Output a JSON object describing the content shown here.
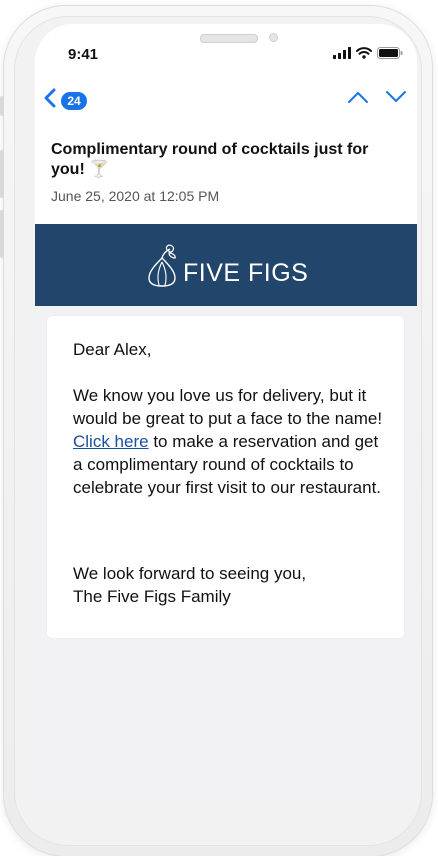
{
  "status_bar": {
    "time": "9:41"
  },
  "nav": {
    "back_count": "24"
  },
  "email": {
    "subject": "Complimentary round of cocktails just for you! 🍸",
    "date": "June 25, 2020 at 12:05 PM"
  },
  "banner": {
    "brand": "FIVE FIGS",
    "background": "#22456c"
  },
  "body": {
    "greeting": "Dear Alex,",
    "para_before_link": "We know you love us for delivery, but it would be great to put a face to the name! ",
    "link_text": "Click here",
    "para_after_link": " to make a reservation and get a complimentary round of cocktails to celebrate your first visit to our restaurant.",
    "closing_line1": "We look forward to seeing you,",
    "closing_line2": "The Five Figs Family"
  },
  "colors": {
    "accent": "#1a73e8",
    "link": "#1b4fa0"
  },
  "icons": [
    "chevron-left-icon",
    "chevron-up-icon",
    "chevron-down-icon",
    "signal-icon",
    "wifi-icon",
    "battery-icon",
    "fig-logo-icon"
  ]
}
